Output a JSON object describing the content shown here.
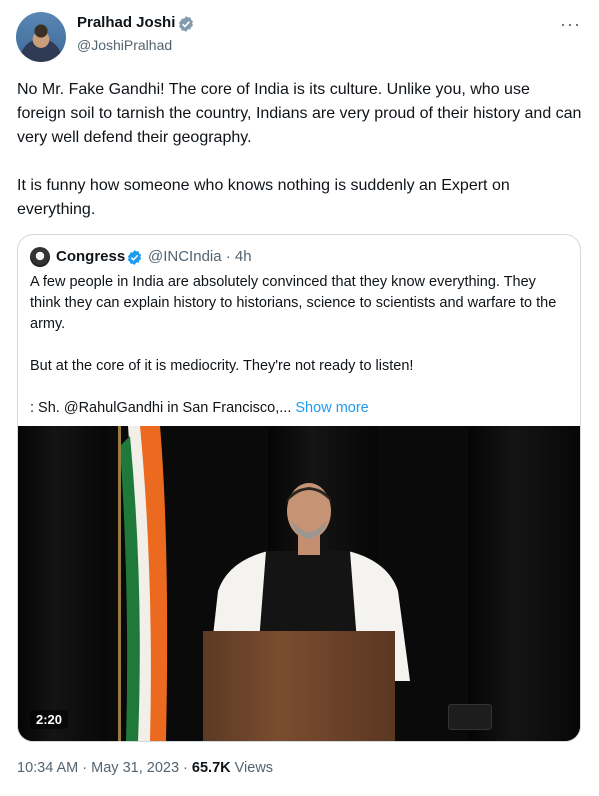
{
  "author": {
    "name": "Pralhad Joshi",
    "handle": "@JoshiPralhad",
    "more_icon": "more-horizontal-icon"
  },
  "tweet": {
    "paragraphs": [
      "No Mr. Fake Gandhi! The core of India is its culture. Unlike you, who use foreign soil to tarnish the country, Indians are very proud of their history and can very well defend their geography.",
      "It is funny how someone who knows nothing is suddenly an Expert on everything."
    ]
  },
  "quote": {
    "name": "Congress",
    "handle_time": "@INCIndia · 4h",
    "paragraphs": [
      "A few people in India are absolutely convinced that they know everything. They think they can explain history to historians, science to scientists and warfare to the army.",
      "But at the core of it is mediocrity. They're not ready to listen!"
    ],
    "last_line": ": Sh. @RahulGandhi in San Francisco,...",
    "show_more": "Show more",
    "video_time": "2:20"
  },
  "footer": {
    "timestamp": "10:34 AM · May 31, 2023 · ",
    "views_count": "65.7K",
    "views_label": " Views"
  },
  "colors": {
    "verified": "#1d9bf0",
    "link": "#1d9bf0",
    "muted": "#536471"
  }
}
